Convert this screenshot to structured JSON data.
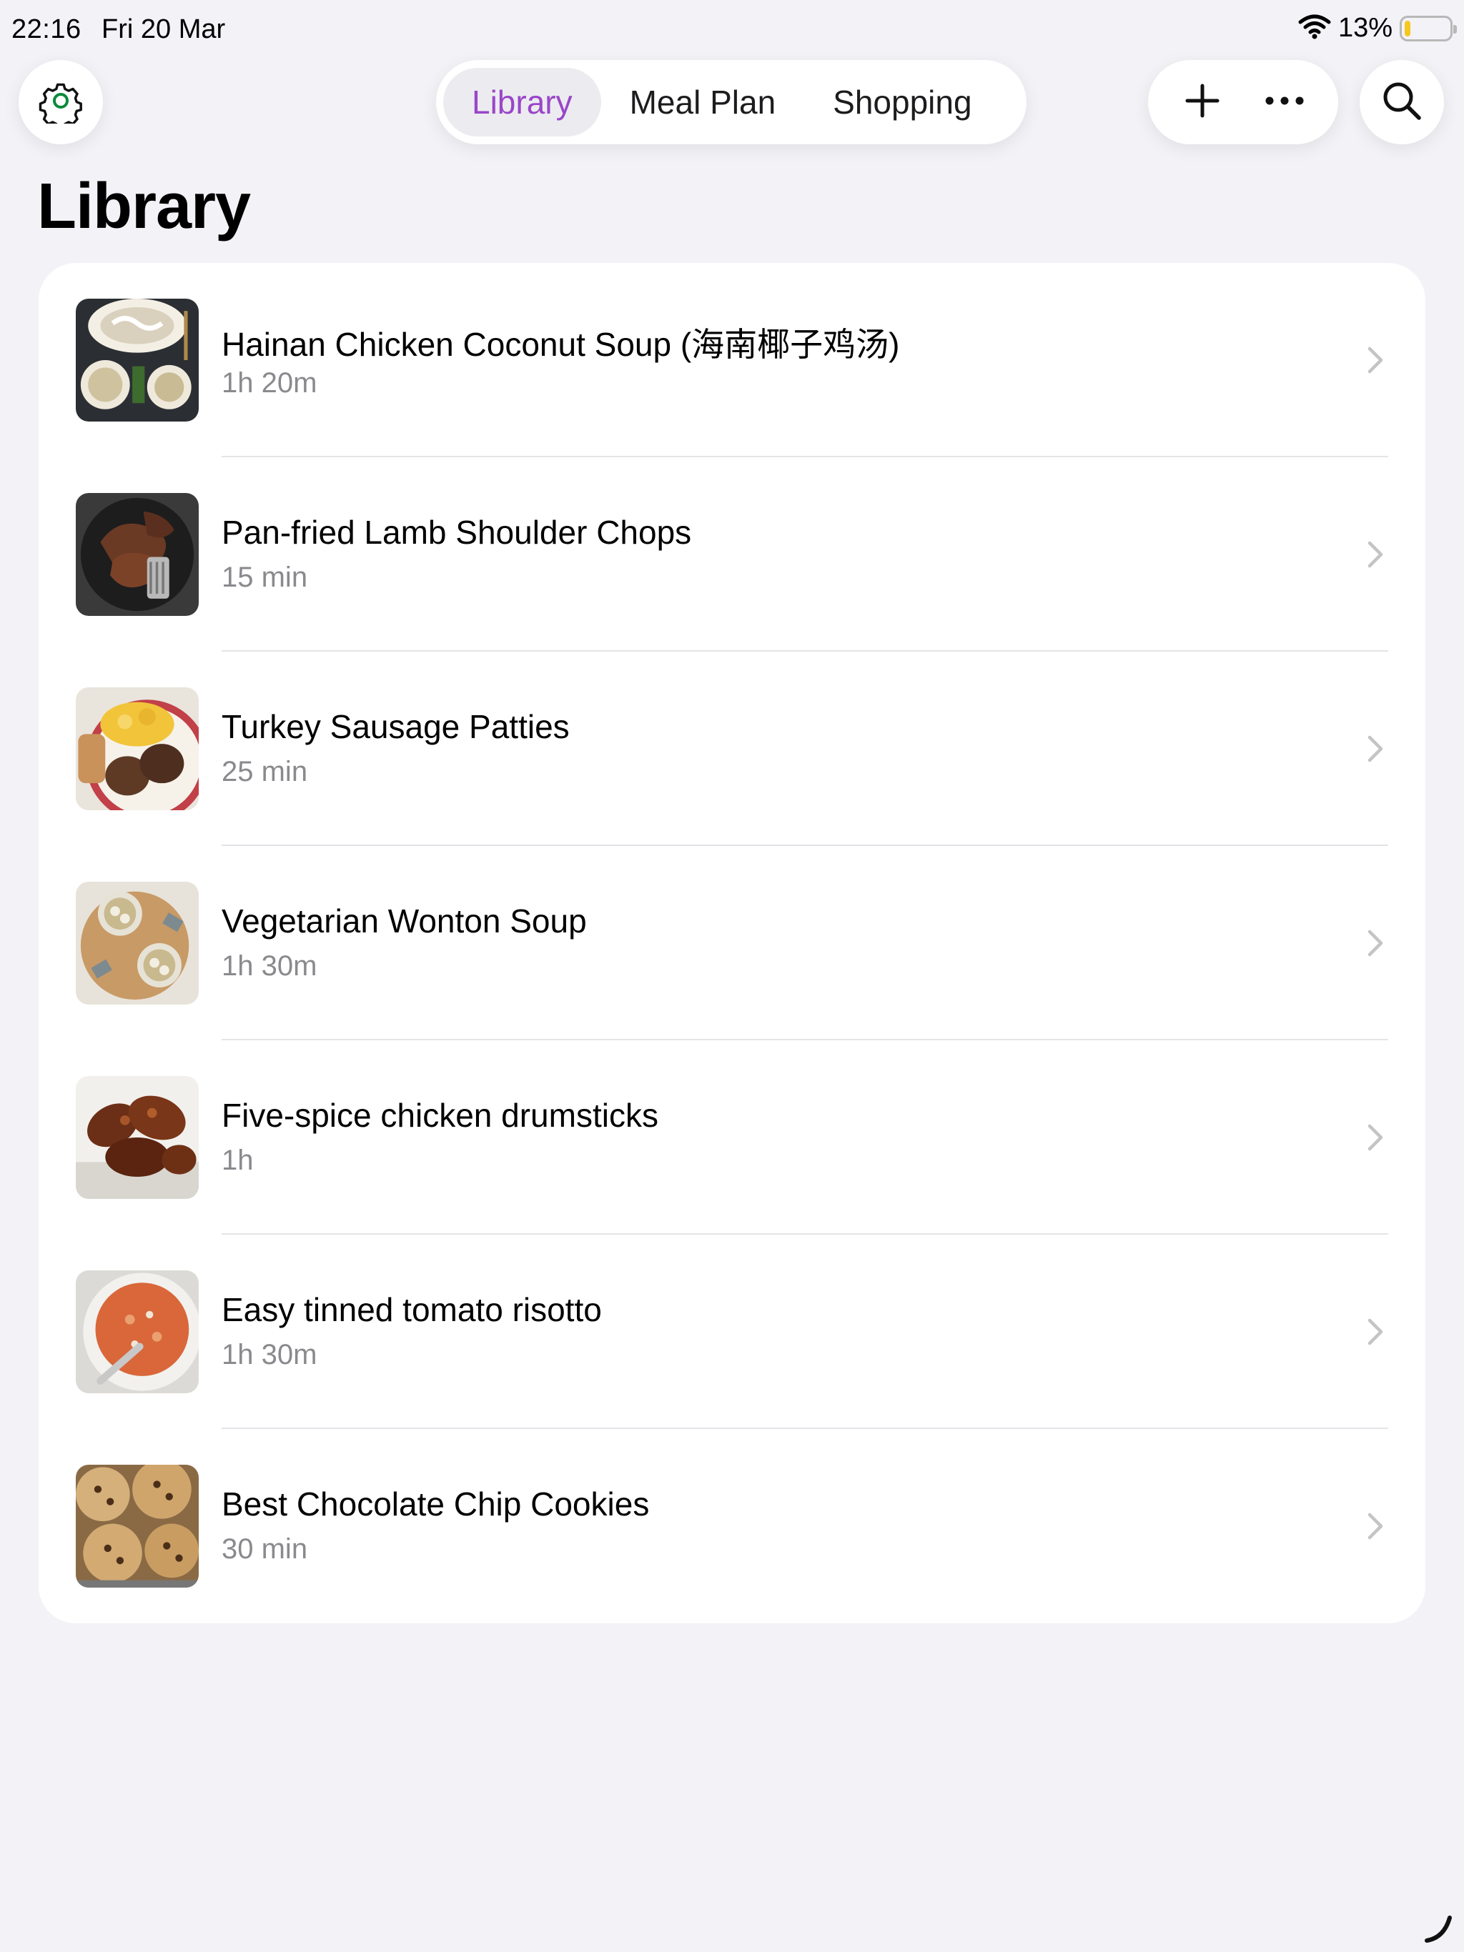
{
  "status": {
    "time": "22:16",
    "date": "Fri 20 Mar",
    "battery_percent": "13%",
    "battery_level": 0.13,
    "battery_color": "#f6c81f"
  },
  "nav": {
    "tabs": [
      {
        "label": "Library",
        "active": true
      },
      {
        "label": "Meal Plan",
        "active": false
      },
      {
        "label": "Shopping",
        "active": false
      }
    ],
    "accent_color": "#9a46c8",
    "icons": {
      "settings": "gear-icon",
      "add": "plus-icon",
      "more": "ellipsis-icon",
      "search": "search-icon"
    }
  },
  "page": {
    "title": "Library"
  },
  "recipes": [
    {
      "title": "Hainan Chicken Coconut Soup (海南椰子鸡汤)",
      "duration": "1h 20m",
      "image": "coconut-soup-photo"
    },
    {
      "title": "Pan-fried Lamb Shoulder Chops",
      "duration": "15 min",
      "image": "lamb-chops-photo"
    },
    {
      "title": "Turkey Sausage Patties",
      "duration": "25 min",
      "image": "sausage-patties-photo"
    },
    {
      "title": "Vegetarian Wonton Soup",
      "duration": "1h 30m",
      "image": "wonton-soup-photo"
    },
    {
      "title": "Five-spice chicken drumsticks",
      "duration": "1h",
      "image": "drumsticks-photo"
    },
    {
      "title": "Easy tinned tomato risotto",
      "duration": "1h 30m",
      "image": "risotto-photo"
    },
    {
      "title": "Best Chocolate Chip Cookies",
      "duration": "30 min",
      "image": "cookies-photo"
    }
  ]
}
